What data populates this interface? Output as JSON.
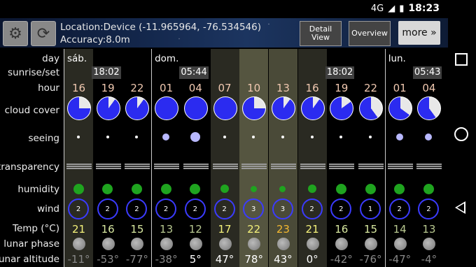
{
  "status": {
    "network": "4G",
    "time": "18:23"
  },
  "header": {
    "location_line": "Location:Device (-11.965964, -76.534546)",
    "accuracy_line": "Accuracy:8.0m",
    "detail_view": "Detail View",
    "overview": "Overview",
    "more": "more »"
  },
  "row_labels": {
    "day": "day",
    "sunrise_set": "sunrise/set",
    "hour": "hour",
    "cloud_cover": "cloud cover",
    "seeing": "seeing",
    "transparency": "transparency",
    "humidity": "humidity",
    "wind": "wind",
    "temp": "Temp (°C)",
    "lunar_phase": "lunar phase",
    "lunar_altitude": "lunar altitude"
  },
  "columns": [
    {
      "day": "sáb.",
      "sun": "",
      "hour": "16",
      "cloud": 0.25,
      "seeing": "small",
      "hum": "large",
      "wind": "2",
      "temp": "21",
      "temp_color": "#f4f17a",
      "alt": "-11°",
      "bg": "#2a2a22"
    },
    {
      "day": "",
      "sun": "18:02",
      "hour": "19",
      "cloud": 0.1,
      "seeing": "small",
      "hum": "large",
      "wind": "2",
      "temp": "16",
      "temp_color": "#d8e8a0",
      "alt": "-53°",
      "bg": "#000"
    },
    {
      "day": "",
      "sun": "",
      "hour": "22",
      "cloud": 0.1,
      "seeing": "small",
      "hum": "large",
      "wind": "2",
      "temp": "15",
      "temp_color": "#d8e8a0",
      "alt": "-77°",
      "bg": "#000"
    },
    {
      "day": "dom.",
      "sun": "",
      "hour": "01",
      "cloud": 0.0,
      "seeing": "medium",
      "hum": "large",
      "wind": "2",
      "temp": "13",
      "temp_color": "#b8c890",
      "alt": "-38°",
      "bg": "#000"
    },
    {
      "day": "",
      "sun": "05:44",
      "hour": "04",
      "cloud": 0.0,
      "seeing": "large",
      "hum": "large",
      "wind": "2",
      "temp": "12",
      "temp_color": "#b8c890",
      "alt": "5°",
      "bg": "#000"
    },
    {
      "day": "",
      "sun": "",
      "hour": "07",
      "cloud": 0.0,
      "seeing": "small",
      "hum": "medium",
      "wind": "2",
      "temp": "17",
      "temp_color": "#f4f17a",
      "alt": "47°",
      "bg": "#2a2a22"
    },
    {
      "day": "",
      "sun": "",
      "hour": "10",
      "cloud": 0.25,
      "seeing": "small",
      "hum": "small",
      "wind": "3",
      "temp": "22",
      "temp_color": "#f4f17a",
      "alt": "78°",
      "bg": "#555540"
    },
    {
      "day": "",
      "sun": "",
      "hour": "13",
      "cloud": 0.1,
      "seeing": "small",
      "hum": "small",
      "wind": "3",
      "temp": "23",
      "temp_color": "#f4b830",
      "alt": "43°",
      "bg": "#4a4a38"
    },
    {
      "day": "",
      "sun": "",
      "hour": "16",
      "cloud": 0.1,
      "seeing": "small",
      "hum": "medium",
      "wind": "2",
      "temp": "21",
      "temp_color": "#f4f17a",
      "alt": "0°",
      "bg": "#2a2a22"
    },
    {
      "day": "",
      "sun": "18:02",
      "hour": "19",
      "cloud": 0.15,
      "seeing": "small",
      "hum": "large",
      "wind": "2",
      "temp": "16",
      "temp_color": "#d8e8a0",
      "alt": "-42°",
      "bg": "#000"
    },
    {
      "day": "",
      "sun": "",
      "hour": "22",
      "cloud": 0.4,
      "seeing": "small",
      "hum": "large",
      "wind": "1",
      "temp": "15",
      "temp_color": "#d8e8a0",
      "alt": "-76°",
      "bg": "#000"
    },
    {
      "day": "lun.",
      "sun": "",
      "hour": "01",
      "cloud": 0.35,
      "seeing": "medium",
      "hum": "large",
      "wind": "2",
      "temp": "14",
      "temp_color": "#b8c890",
      "alt": "-47°",
      "bg": "#000"
    },
    {
      "day": "",
      "sun": "05:43",
      "hour": "04",
      "cloud": 0.4,
      "seeing": "medium",
      "hum": "large",
      "wind": "2",
      "temp": "13",
      "temp_color": "#b8c890",
      "alt": "-4°",
      "bg": "#000"
    }
  ]
}
